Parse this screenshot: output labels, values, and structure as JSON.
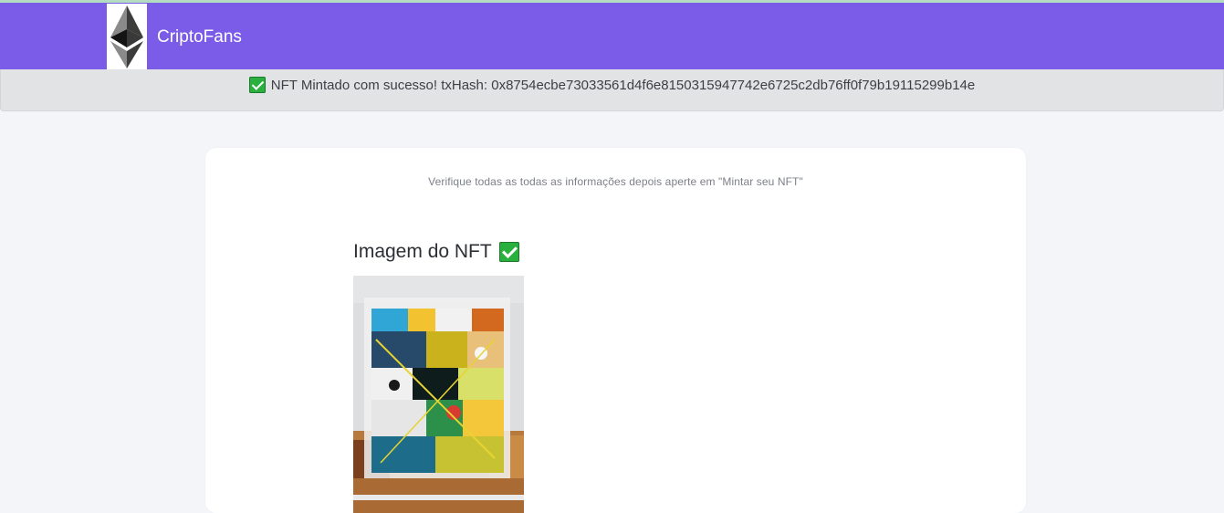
{
  "navbar": {
    "brand": "CriptoFans",
    "logo_icon": "ethereum-icon",
    "background": "#7a5ce8"
  },
  "alert": {
    "icon": "check-mark-icon",
    "message": "NFT Mintado com sucesso! txHash: 0x8754ecbe73033561d4f6e8150315947742e6725c2db76ff0f79b19115299b14e"
  },
  "card": {
    "instructions": "Verifique todas as todas as informações depois aperte em \"Mintar seu NFT\"",
    "image_section": {
      "title": "Imagem do NFT",
      "icon": "check-mark-icon"
    }
  },
  "colors": {
    "success_green": "#2ab03e",
    "page_background": "#f3f5f8",
    "alert_background": "#e2e3e5"
  }
}
